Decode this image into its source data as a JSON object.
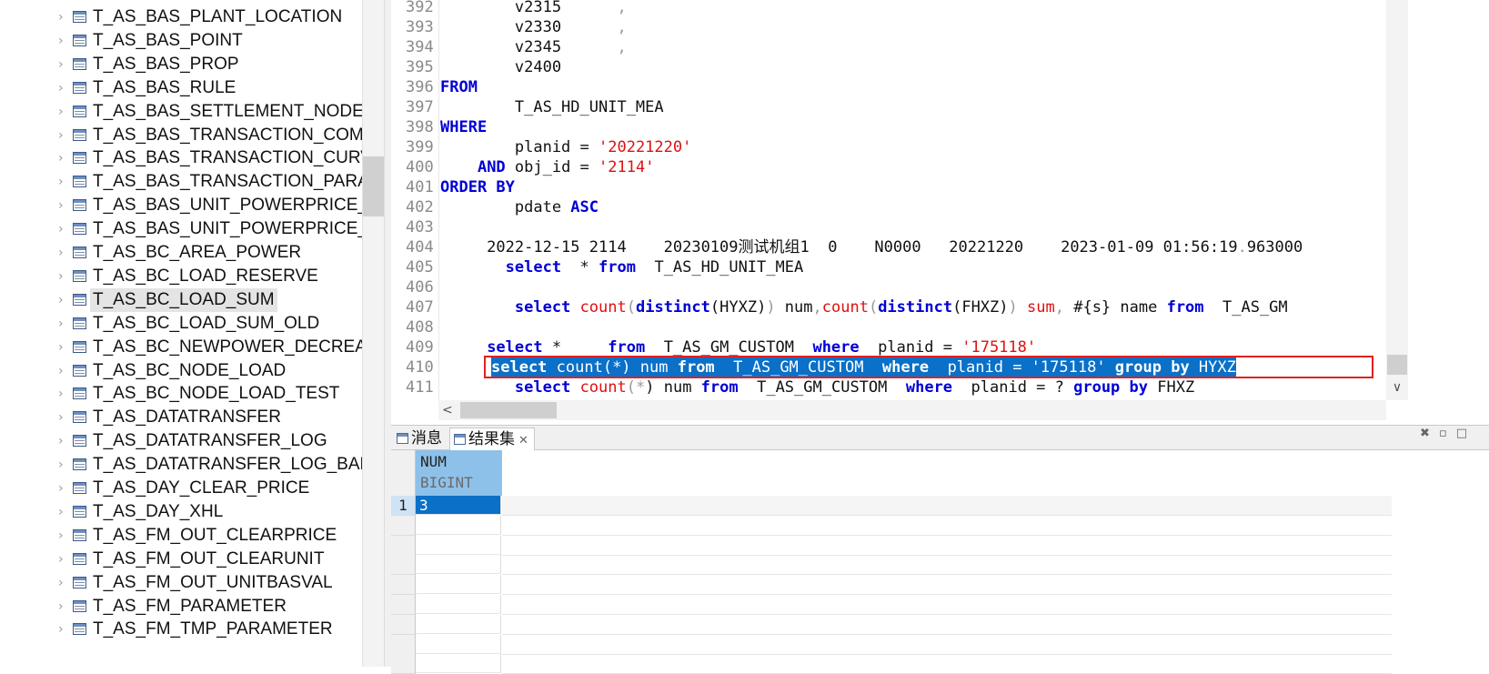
{
  "tree": {
    "items": [
      {
        "label": "T_AS_BAS_PLANT_LOCATION",
        "selected": false
      },
      {
        "label": "T_AS_BAS_POINT",
        "selected": false
      },
      {
        "label": "T_AS_BAS_PROP",
        "selected": false
      },
      {
        "label": "T_AS_BAS_RULE",
        "selected": false
      },
      {
        "label": "T_AS_BAS_SETTLEMENT_NODE",
        "selected": false
      },
      {
        "label": "T_AS_BAS_TRANSACTION_COMB_C(",
        "selected": false
      },
      {
        "label": "T_AS_BAS_TRANSACTION_CURVE",
        "selected": false
      },
      {
        "label": "T_AS_BAS_TRANSACTION_PARA",
        "selected": false
      },
      {
        "label": "T_AS_BAS_UNIT_POWERPRICE_TEMP",
        "selected": false
      },
      {
        "label": "T_AS_BAS_UNIT_POWERPRICE_TEMP",
        "selected": false
      },
      {
        "label": "T_AS_BC_AREA_POWER",
        "selected": false
      },
      {
        "label": "T_AS_BC_LOAD_RESERVE",
        "selected": false
      },
      {
        "label": "T_AS_BC_LOAD_SUM",
        "selected": true
      },
      {
        "label": "T_AS_BC_LOAD_SUM_OLD",
        "selected": false
      },
      {
        "label": "T_AS_BC_NEWPOWER_DECREASE_A",
        "selected": false
      },
      {
        "label": "T_AS_BC_NODE_LOAD",
        "selected": false
      },
      {
        "label": "T_AS_BC_NODE_LOAD_TEST",
        "selected": false
      },
      {
        "label": "T_AS_DATATRANSFER",
        "selected": false
      },
      {
        "label": "T_AS_DATATRANSFER_LOG",
        "selected": false
      },
      {
        "label": "T_AS_DATATRANSFER_LOG_BAK",
        "selected": false
      },
      {
        "label": "T_AS_DAY_CLEAR_PRICE",
        "selected": false
      },
      {
        "label": "T_AS_DAY_XHL",
        "selected": false
      },
      {
        "label": "T_AS_FM_OUT_CLEARPRICE",
        "selected": false
      },
      {
        "label": "T_AS_FM_OUT_CLEARUNIT",
        "selected": false
      },
      {
        "label": "T_AS_FM_OUT_UNITBASVAL",
        "selected": false
      },
      {
        "label": "T_AS_FM_PARAMETER",
        "selected": false
      },
      {
        "label": "T_AS_FM_TMP_PARAMETER",
        "selected": false
      }
    ],
    "expander_icon": "chevron-right-icon",
    "item_icon": "table-icon"
  },
  "editor": {
    "lines": [
      {
        "num": "392",
        "tokens": [
          {
            "t": "        v2315      "
          },
          {
            "t": ",",
            "c": "pun"
          }
        ]
      },
      {
        "num": "393",
        "tokens": [
          {
            "t": "        v2330      "
          },
          {
            "t": ",",
            "c": "pun"
          }
        ]
      },
      {
        "num": "394",
        "tokens": [
          {
            "t": "        v2345      "
          },
          {
            "t": ",",
            "c": "pun"
          }
        ]
      },
      {
        "num": "395",
        "tokens": [
          {
            "t": "        v2400"
          }
        ]
      },
      {
        "num": "396",
        "tokens": [
          {
            "t": "FROM",
            "c": "kw"
          }
        ]
      },
      {
        "num": "397",
        "tokens": [
          {
            "t": "        T_AS_HD_UNIT_MEA"
          }
        ]
      },
      {
        "num": "398",
        "tokens": [
          {
            "t": "WHERE",
            "c": "kw"
          }
        ]
      },
      {
        "num": "399",
        "tokens": [
          {
            "t": "        planid = "
          },
          {
            "t": "'20221220'",
            "c": "str"
          }
        ]
      },
      {
        "num": "400",
        "tokens": [
          {
            "t": "    "
          },
          {
            "t": "AND",
            "c": "kw"
          },
          {
            "t": " obj_id = "
          },
          {
            "t": "'2114'",
            "c": "str"
          }
        ]
      },
      {
        "num": "401",
        "tokens": [
          {
            "t": "ORDER BY",
            "c": "kw"
          }
        ]
      },
      {
        "num": "402",
        "tokens": [
          {
            "t": "        pdate "
          },
          {
            "t": "ASC",
            "c": "kw"
          }
        ]
      },
      {
        "num": "403",
        "tokens": []
      },
      {
        "num": "404",
        "tokens": [
          {
            "t": "     2022-12-15 2114    20230109测试机组1  0    N0000   20221220    2023-01-09 01:56:19"
          },
          {
            "t": ".",
            "c": "pun"
          },
          {
            "t": "963000"
          }
        ]
      },
      {
        "num": "405",
        "tokens": [
          {
            "t": "       "
          },
          {
            "t": "select",
            "c": "kw"
          },
          {
            "t": "  * "
          },
          {
            "t": "from",
            "c": "kw"
          },
          {
            "t": "  T_AS_HD_UNIT_MEA"
          }
        ]
      },
      {
        "num": "406",
        "tokens": []
      },
      {
        "num": "407",
        "tokens": [
          {
            "t": "        "
          },
          {
            "t": "select",
            "c": "kw"
          },
          {
            "t": " "
          },
          {
            "t": "count",
            "c": "str"
          },
          {
            "t": "(",
            "c": "pun"
          },
          {
            "t": "distinct",
            "c": "kw"
          },
          {
            "t": "(HYXZ)"
          },
          {
            "t": ")",
            "c": "pun"
          },
          {
            "t": " num"
          },
          {
            "t": ",",
            "c": "pun"
          },
          {
            "t": "count",
            "c": "str"
          },
          {
            "t": "(",
            "c": "pun"
          },
          {
            "t": "distinct",
            "c": "kw"
          },
          {
            "t": "(FHXZ)"
          },
          {
            "t": ")",
            "c": "pun"
          },
          {
            "t": " "
          },
          {
            "t": "sum",
            "c": "str"
          },
          {
            "t": ",",
            "c": "pun"
          },
          {
            "t": " #{s} name "
          },
          {
            "t": "from",
            "c": "kw"
          },
          {
            "t": "  T_AS_GM"
          }
        ]
      },
      {
        "num": "408",
        "tokens": []
      },
      {
        "num": "409",
        "tokens": [
          {
            "t": "     "
          },
          {
            "t": "select",
            "c": "kw"
          },
          {
            "t": " *     "
          },
          {
            "t": "from",
            "c": "kw"
          },
          {
            "t": "  T_AS_GM_CUSTOM  "
          },
          {
            "t": "where",
            "c": "kw"
          },
          {
            "t": "  planid = "
          },
          {
            "t": "'175118'",
            "c": "str"
          }
        ]
      },
      {
        "num": "410",
        "highlight": true,
        "tokens": [
          {
            "t": "        "
          },
          {
            "t": "select",
            "c": "kw"
          },
          {
            "t": " count(*) num "
          },
          {
            "t": "from",
            "c": "kw"
          },
          {
            "t": "  T_AS_GM_CUSTOM  "
          },
          {
            "t": "where",
            "c": "kw"
          },
          {
            "t": "  planid = '175118' "
          },
          {
            "t": "group by",
            "c": "kw"
          },
          {
            "t": " HYXZ"
          }
        ]
      },
      {
        "num": "411",
        "tokens": [
          {
            "t": "        "
          },
          {
            "t": "select",
            "c": "kw"
          },
          {
            "t": " "
          },
          {
            "t": "count",
            "c": "str"
          },
          {
            "t": "(",
            "c": "pun"
          },
          {
            "t": "*",
            "c": "pun"
          },
          {
            "t": ") num "
          },
          {
            "t": "from",
            "c": "kw"
          },
          {
            "t": "  T_AS_GM_CUSTOM  "
          },
          {
            "t": "where",
            "c": "kw"
          },
          {
            "t": "  planid = ? "
          },
          {
            "t": "group by",
            "c": "kw"
          },
          {
            "t": " FHXZ"
          }
        ]
      }
    ],
    "vscroll_down_icon": "chevron-down-icon",
    "hscroll_left_icon": "chevron-left-icon"
  },
  "results": {
    "tabs": [
      {
        "label": "消息",
        "icon": "message-icon"
      },
      {
        "label": "结果集",
        "icon": "table-icon",
        "closable": true
      }
    ],
    "panel_controls": [
      "restore-icon",
      "minimize-icon",
      "maximize-icon"
    ],
    "columns": [
      {
        "name": "NUM",
        "type": "BIGINT"
      }
    ],
    "rows": [
      {
        "num": "1",
        "values": [
          "3"
        ]
      }
    ],
    "empty_rows": 8
  },
  "colors": {
    "keyword": "#0000d4",
    "string": "#e01010",
    "selection": "#0a70c8",
    "header": "#8ec1ea",
    "highlight_box": "#e22020"
  }
}
